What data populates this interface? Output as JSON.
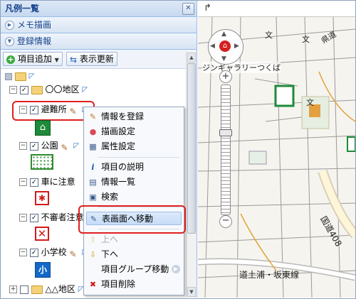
{
  "panel": {
    "title": "凡例一覧"
  },
  "sections": {
    "memo": "メモ描画",
    "registration": "登録情報"
  },
  "toolbar": {
    "add_item": "項目追加",
    "refresh": "表示更新"
  },
  "tree": {
    "group1": "〇〇地区",
    "shelter": "避難所",
    "park": "公園",
    "car_caution": "車に注意",
    "suspicious": "不審者注意",
    "school": "小学校",
    "school_badge": "小",
    "group2": "△△地区"
  },
  "menu": {
    "items": [
      {
        "label": "情報を登録",
        "icon": "pencil-icon"
      },
      {
        "label": "描画設定",
        "icon": "palette-icon"
      },
      {
        "label": "属性設定",
        "icon": "table-icon"
      },
      {
        "label": "項目の説明",
        "icon": "info-icon"
      },
      {
        "label": "情報一覧",
        "icon": "list-icon"
      },
      {
        "label": "検索",
        "icon": "search-icon"
      },
      {
        "label": "表画面へ移動",
        "icon": "move-to-top-icon"
      },
      {
        "label": "上へ",
        "icon": "up-arrow-icon"
      },
      {
        "label": "下へ",
        "icon": "down-arrow-icon"
      },
      {
        "label": "項目グループ移動",
        "icon": "submenu-arrow-icon"
      },
      {
        "label": "項目削除",
        "icon": "delete-icon"
      }
    ]
  },
  "map": {
    "labels": {
      "gallery": "ジンギャラリーつくば",
      "road1": "道土浦・坂東線",
      "road2": "国道408",
      "mark1": "文",
      "mark2": "文",
      "mark3": "文",
      "mark4": "県道"
    }
  },
  "colors": {
    "accent": "#15428b",
    "highlight": "#e02020",
    "park_green": "#2e8b2e"
  }
}
